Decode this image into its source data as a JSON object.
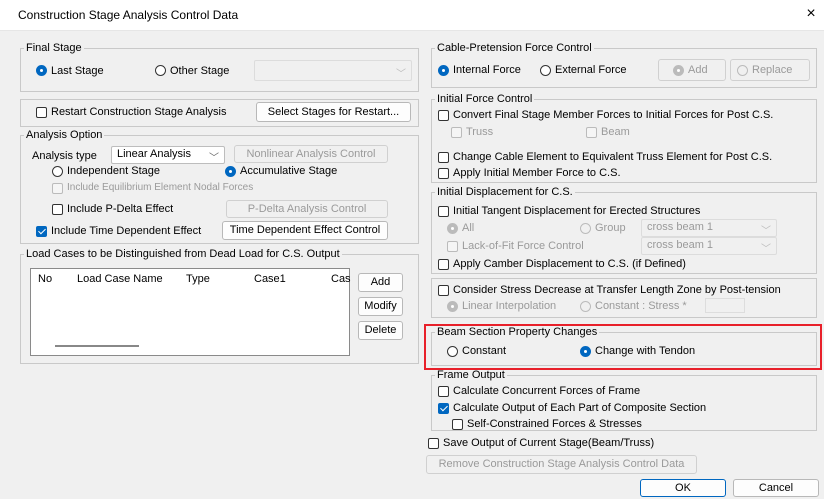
{
  "window": {
    "title": "Construction Stage Analysis Control Data",
    "close": "×"
  },
  "final_stage": {
    "legend": "Final Stage",
    "last_stage": "Last Stage",
    "other_stage": "Other Stage"
  },
  "restart": {
    "checkbox": "Restart Construction Stage Analysis",
    "button": "Select Stages for Restart..."
  },
  "analysis_option": {
    "legend": "Analysis Option",
    "type_label": "Analysis type",
    "type_value": "Linear Analysis",
    "nonlinear_button": "Nonlinear Analysis Control",
    "independent": "Independent Stage",
    "accumulative": "Accumulative Stage",
    "include_equilibrium": "Include Equilibrium Element Nodal Forces",
    "include_pdelta": "Include P-Delta Effect",
    "pdelta_button": "P-Delta Analysis Control",
    "include_time": "Include Time Dependent Effect",
    "time_button": "Time Dependent Effect Control"
  },
  "load_cases": {
    "legend": "Load Cases to be Distinguished from Dead Load for C.S. Output",
    "columns": [
      "No",
      "Load Case Name",
      "Type",
      "Case1",
      "Cas"
    ],
    "add": "Add",
    "modify": "Modify",
    "delete": "Delete"
  },
  "cable": {
    "legend": "Cable-Pretension Force Control",
    "internal": "Internal Force",
    "external": "External Force",
    "add": "Add",
    "replace": "Replace"
  },
  "initial_force": {
    "legend": "Initial Force Control",
    "convert": "Convert Final Stage Member Forces to Initial Forces for Post C.S.",
    "truss": "Truss",
    "beam": "Beam",
    "change_cable": "Change Cable Element to Equivalent Truss Element for Post C.S.",
    "apply_initial": "Apply Initial Member Force to C.S."
  },
  "initial_disp": {
    "legend": "Initial Displacement for C.S.",
    "tangent": "Initial Tangent Displacement for Erected Structures",
    "all": "All",
    "group": "Group",
    "group_value": "cross beam 1",
    "lack_of_fit": "Lack-of-Fit Force Control",
    "lof_value": "cross beam 1",
    "camber": "Apply Camber Displacement to C.S. (if Defined)"
  },
  "stress_decrease": {
    "checkbox": "Consider Stress Decrease at Transfer Length Zone by Post-tension",
    "linear": "Linear Interpolation",
    "constant": "Constant : Stress *"
  },
  "beam_section": {
    "legend": "Beam Section Property Changes",
    "constant": "Constant",
    "change_tendon": "Change with Tendon"
  },
  "frame_output": {
    "legend": "Frame Output",
    "concurrent": "Calculate Concurrent Forces of Frame",
    "composite": "Calculate Output of Each Part of Composite Section",
    "self_constrained": "Self-Constrained Forces & Stresses"
  },
  "save_output": "Save Output of Current Stage(Beam/Truss)",
  "remove_button": "Remove Construction Stage Analysis Control Data",
  "ok": "OK",
  "cancel": "Cancel",
  "colors": {
    "accent": "#0067c0",
    "highlight": "#e8202a"
  }
}
